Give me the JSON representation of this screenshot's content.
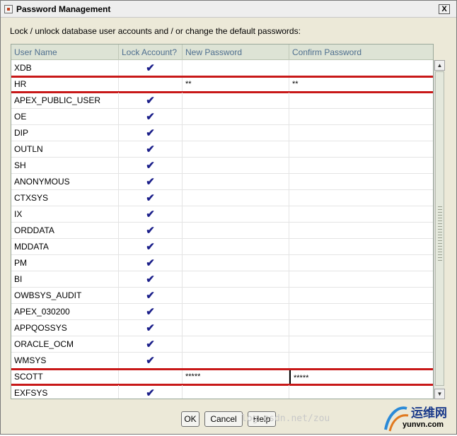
{
  "window": {
    "title": "Password Management",
    "close_label": "X"
  },
  "instruction": "Lock / unlock database user accounts and / or change the default passwords:",
  "table": {
    "columns": [
      "User Name",
      "Lock Account?",
      "New Password",
      "Confirm Password"
    ],
    "rows": [
      {
        "user": "XDB",
        "locked": true,
        "new_password": "",
        "confirm_password": ""
      },
      {
        "user": "HR",
        "locked": false,
        "new_password": "**",
        "confirm_password": "**"
      },
      {
        "user": "APEX_PUBLIC_USER",
        "locked": true,
        "new_password": "",
        "confirm_password": ""
      },
      {
        "user": "OE",
        "locked": true,
        "new_password": "",
        "confirm_password": ""
      },
      {
        "user": "DIP",
        "locked": true,
        "new_password": "",
        "confirm_password": ""
      },
      {
        "user": "OUTLN",
        "locked": true,
        "new_password": "",
        "confirm_password": ""
      },
      {
        "user": "SH",
        "locked": true,
        "new_password": "",
        "confirm_password": ""
      },
      {
        "user": "ANONYMOUS",
        "locked": true,
        "new_password": "",
        "confirm_password": ""
      },
      {
        "user": "CTXSYS",
        "locked": true,
        "new_password": "",
        "confirm_password": ""
      },
      {
        "user": "IX",
        "locked": true,
        "new_password": "",
        "confirm_password": ""
      },
      {
        "user": "ORDDATA",
        "locked": true,
        "new_password": "",
        "confirm_password": ""
      },
      {
        "user": "MDDATA",
        "locked": true,
        "new_password": "",
        "confirm_password": ""
      },
      {
        "user": "PM",
        "locked": true,
        "new_password": "",
        "confirm_password": ""
      },
      {
        "user": "BI",
        "locked": true,
        "new_password": "",
        "confirm_password": ""
      },
      {
        "user": "OWBSYS_AUDIT",
        "locked": true,
        "new_password": "",
        "confirm_password": ""
      },
      {
        "user": "APEX_030200",
        "locked": true,
        "new_password": "",
        "confirm_password": ""
      },
      {
        "user": "APPQOSSYS",
        "locked": true,
        "new_password": "",
        "confirm_password": ""
      },
      {
        "user": "ORACLE_OCM",
        "locked": true,
        "new_password": "",
        "confirm_password": ""
      },
      {
        "user": "WMSYS",
        "locked": true,
        "new_password": "",
        "confirm_password": ""
      },
      {
        "user": "SCOTT",
        "locked": false,
        "new_password": "*****",
        "confirm_password": "*****"
      },
      {
        "user": "EXFSYS",
        "locked": true,
        "new_password": "",
        "confirm_password": ""
      }
    ],
    "check_glyph": "✔",
    "highlighted_users": [
      "HR",
      "SCOTT"
    ],
    "highlight_color": "#c81818"
  },
  "buttons": {
    "ok": "OK",
    "cancel": "Cancel",
    "help": "Help"
  },
  "watermark": "log.csdn.net/zou",
  "logo": {
    "text_cn": "运维网",
    "text_en": "yunvn.com"
  }
}
